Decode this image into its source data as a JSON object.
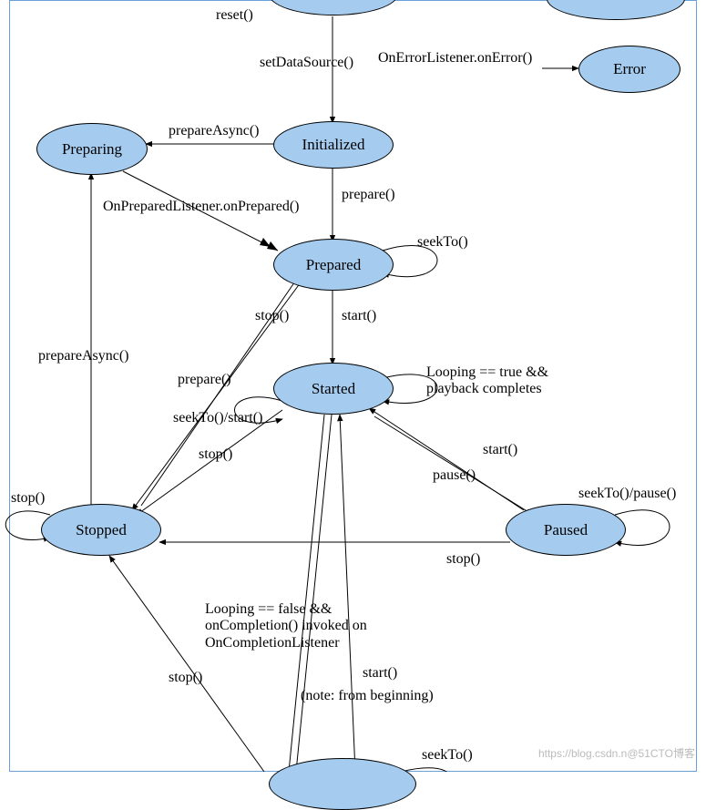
{
  "diagram": {
    "nodes": {
      "idle_top": "",
      "error": "Error",
      "preparing": "Preparing",
      "initialized": "Initialized",
      "prepared": "Prepared",
      "started": "Started",
      "stopped": "Stopped",
      "paused": "Paused",
      "completed_bottom": ""
    },
    "labels": {
      "reset": "reset()",
      "setDataSource": "setDataSource()",
      "onError": "OnErrorListener.onError()",
      "prepareAsync_top": "prepareAsync()",
      "prepare": "prepare()",
      "onPrepared": "OnPreparedListener.onPrepared()",
      "seekTo_prepared": "seekTo()",
      "stop_prepared": "stop()",
      "start_prepared": "start()",
      "prepareAsync_left": "prepareAsync()",
      "prepare_left": "prepare()",
      "seekTo_start": "seekTo()/start()",
      "looping_true": "Looping == true && playback completes",
      "stop_started": "stop()",
      "start_paused": "start()",
      "pause": "pause()",
      "stop_self": "stop()",
      "seekTo_pause": "seekTo()/pause()",
      "stop_paused": "stop()",
      "looping_false": "Looping == false && onCompletion() invoked on OnCompletionListener",
      "stop_completed": "stop()",
      "start_completed": "start()",
      "note_beginning": "(note: from beginning)",
      "seekTo_completed": "seekTo()"
    }
  },
  "watermark": "https://blog.csdn.n@51CTO博客"
}
